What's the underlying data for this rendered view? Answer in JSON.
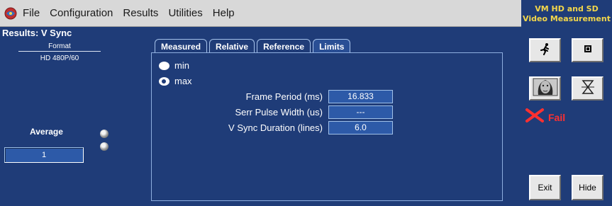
{
  "menu": {
    "app_icon": "app-logo-icon",
    "items": [
      "File",
      "Configuration",
      "Results",
      "Utilities",
      "Help"
    ]
  },
  "brand": {
    "line1": "VM HD and SD",
    "line2": "Video Measurement"
  },
  "left_panel": {
    "title": "Results: V Sync",
    "format_label": "Format",
    "format_value": "HD 480P/60",
    "average_label": "Average",
    "average_value": "1"
  },
  "tabs": [
    "Measured",
    "Relative",
    "Reference",
    "Limits"
  ],
  "active_tab": "Limits",
  "limit_options": [
    {
      "label": "min",
      "selected": false
    },
    {
      "label": "max",
      "selected": true
    }
  ],
  "fields": [
    {
      "label": "Frame Period (ms)",
      "value": "16.833"
    },
    {
      "label": "Serr Pulse Width (us)",
      "value": "---"
    },
    {
      "label": "V Sync Duration (lines)",
      "value": "6.0"
    }
  ],
  "right_panel": {
    "run_icon": "running-man-icon",
    "stop_icon": "stop-icon",
    "image_icon": "face-image-icon",
    "hourglass_icon": "hourglass-icon",
    "status_icon": "fail-x-icon",
    "status_text": "Fail",
    "exit_label": "Exit",
    "hide_label": "Hide"
  },
  "colors": {
    "panel_bg": "#1f3c78",
    "field_bg": "#2d5aa8",
    "brand_text": "#f2d64a",
    "fail": "#ff3030"
  }
}
